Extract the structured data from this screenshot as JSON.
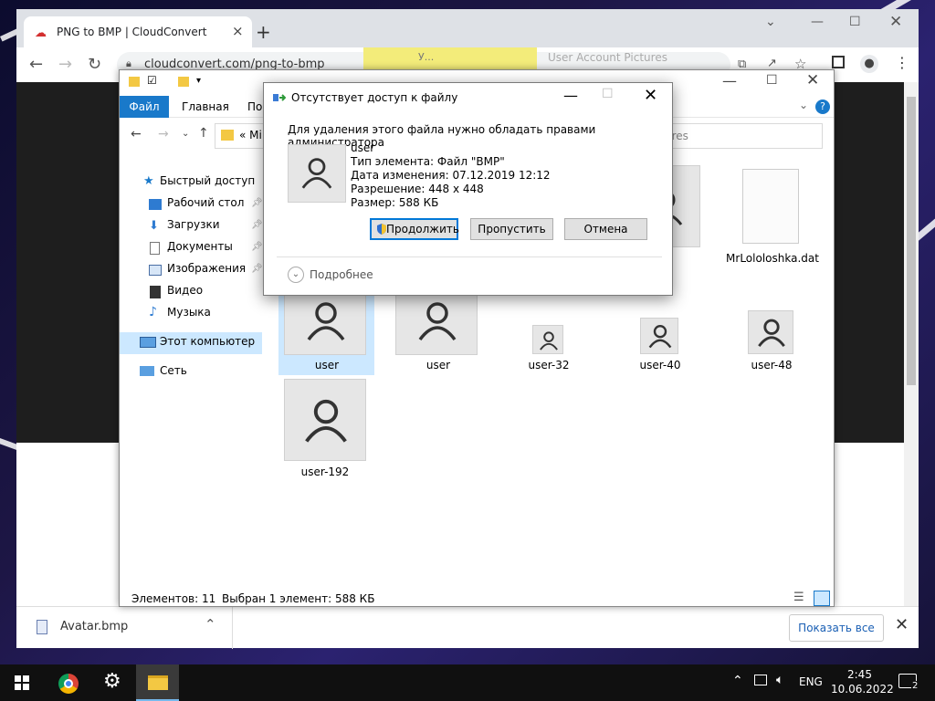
{
  "browser": {
    "tab_title": "PNG to BMP | CloudConvert",
    "url": "cloudconvert.com/png-to-bmp",
    "page_hint_left": "У...",
    "page_hint_right": "User Account Pictures"
  },
  "download_bar": {
    "file_name": "Avatar.bmp",
    "show_all_label": "Показать все"
  },
  "explorer": {
    "ribbon_tabs": [
      "Файл",
      "Главная",
      "Под"
    ],
    "address": "Mi",
    "search_placeholder": "ures",
    "nav": [
      {
        "label": "Быстрый доступ"
      },
      {
        "label": "Рабочий стол"
      },
      {
        "label": "Загрузки"
      },
      {
        "label": "Документы"
      },
      {
        "label": "Изображения"
      },
      {
        "label": "Видео"
      },
      {
        "label": "Музыка"
      },
      {
        "label": "Этот компьютер"
      },
      {
        "label": "Сеть"
      }
    ],
    "files": [
      {
        "label": "MrLololoshka.dat"
      },
      {
        "label": "user"
      },
      {
        "label": "user"
      },
      {
        "label": "user-32"
      },
      {
        "label": "user-40"
      },
      {
        "label": "user-48"
      },
      {
        "label": "user-192"
      }
    ],
    "status_count": "Элементов: 11",
    "status_selected": "Выбран 1 элемент: 588 КБ"
  },
  "dialog": {
    "title": "Отсутствует доступ к файлу",
    "message": "Для удаления этого файла нужно обладать правами администратора",
    "file_name": "user",
    "type": "Тип элемента: Файл \"BMP\"",
    "modified": "Дата изменения: 07.12.2019 12:12",
    "resolution": "Разрешение: 448 x 448",
    "size": "Размер: 588 КБ",
    "continue_label": "Продолжить",
    "skip_label": "Пропустить",
    "cancel_label": "Отмена",
    "more_label": "Подробнее"
  },
  "taskbar": {
    "language": "ENG",
    "time": "2:45",
    "date": "10.06.2022",
    "notifications": "2"
  }
}
